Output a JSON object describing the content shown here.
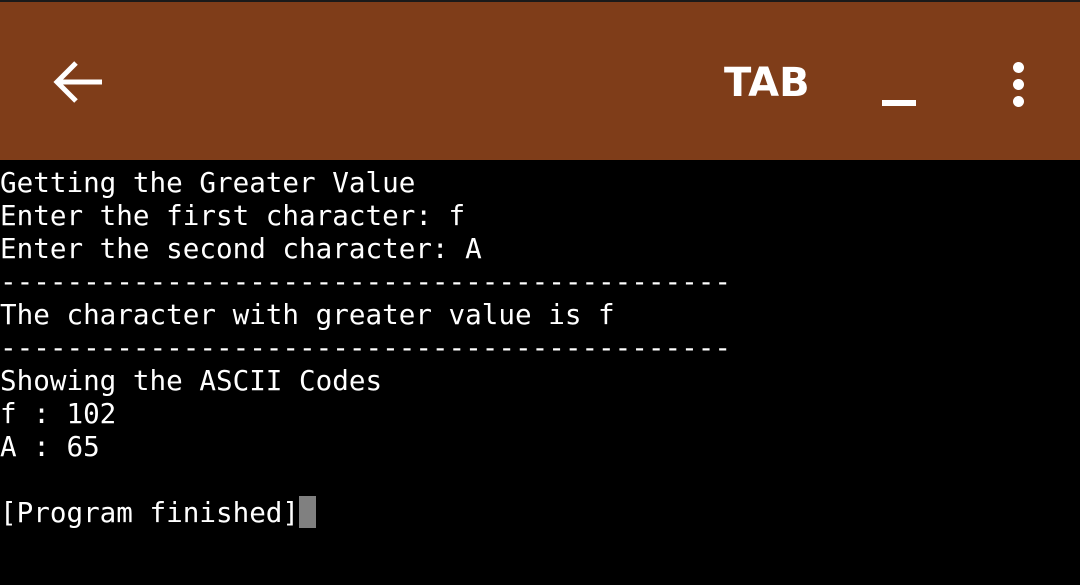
{
  "toolbar": {
    "background_color": "#7f3d19",
    "back_icon": "arrow-left-icon",
    "tab_label": "TAB",
    "underscore_label": "_",
    "menu_icon": "more-vertical-icon"
  },
  "terminal": {
    "lines": [
      "Getting the Greater Value",
      "Enter the first character: f",
      "Enter the second character: A",
      "--------------------------------------------",
      "The character with greater value is f",
      "--------------------------------------------",
      "Showing the ASCII Codes",
      "f : 102",
      "A : 65",
      "",
      "[Program finished]"
    ],
    "cursor_color": "#808080"
  }
}
